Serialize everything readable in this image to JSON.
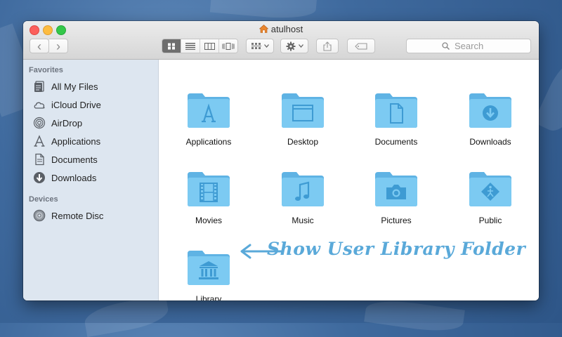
{
  "window": {
    "title": "atulhost"
  },
  "toolbar": {
    "back_glyph": "‹",
    "forward_glyph": "›",
    "view_modes": [
      "icon-view",
      "list-view",
      "column-view",
      "cover-flow-view"
    ],
    "active_view": "icon-view",
    "search_placeholder": "Search"
  },
  "sidebar": {
    "favorites_header": "Favorites",
    "favorites": [
      {
        "label": "All My Files",
        "icon": "all-files-icon"
      },
      {
        "label": "iCloud Drive",
        "icon": "cloud-icon"
      },
      {
        "label": "AirDrop",
        "icon": "airdrop-icon"
      },
      {
        "label": "Applications",
        "icon": "applications-icon"
      },
      {
        "label": "Documents",
        "icon": "documents-icon"
      },
      {
        "label": "Downloads",
        "icon": "downloads-icon"
      }
    ],
    "devices_header": "Devices",
    "devices": [
      {
        "label": "Remote Disc",
        "icon": "disc-icon"
      }
    ]
  },
  "folders": [
    {
      "label": "Applications",
      "icon": "applications-folder-icon"
    },
    {
      "label": "Desktop",
      "icon": "desktop-folder-icon"
    },
    {
      "label": "Documents",
      "icon": "documents-folder-icon"
    },
    {
      "label": "Downloads",
      "icon": "downloads-folder-icon"
    },
    {
      "label": "Movies",
      "icon": "movies-folder-icon"
    },
    {
      "label": "Music",
      "icon": "music-folder-icon"
    },
    {
      "label": "Pictures",
      "icon": "pictures-folder-icon"
    },
    {
      "label": "Public",
      "icon": "public-folder-icon"
    },
    {
      "label": "Library",
      "icon": "library-folder-icon"
    }
  ],
  "annotation": {
    "text": "Show User Library Folder"
  },
  "colors": {
    "folder": "#7ccaf2",
    "folder_dark": "#5fb3e4",
    "folder_glyph": "#3e9bd3",
    "annotation": "#5aa9d9"
  }
}
